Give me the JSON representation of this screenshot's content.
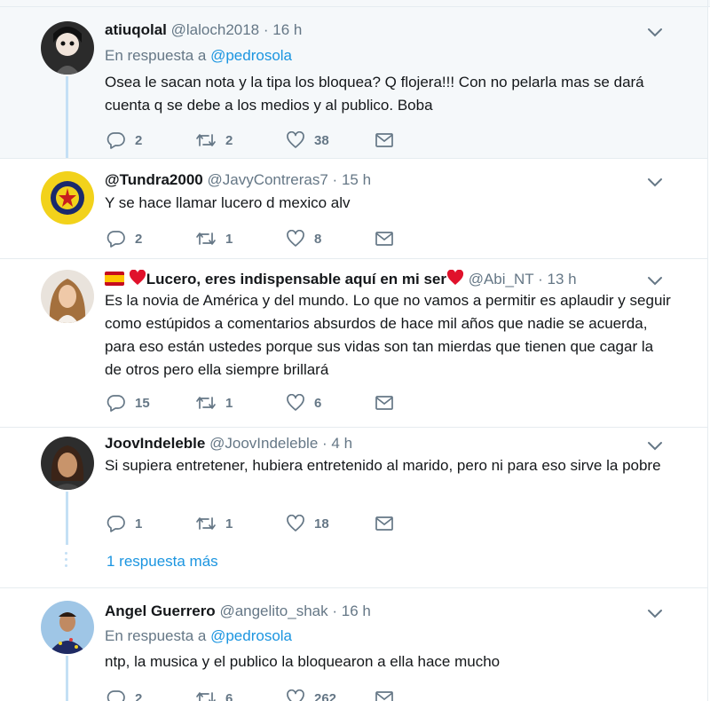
{
  "colors": {
    "name": "#14171a",
    "meta": "#657786",
    "link": "#1b95e0",
    "thread": "#c4e0f5",
    "highlight": "#f5f8fa"
  },
  "tweets": [
    {
      "name": "atiuqolal",
      "handle": "@laloch2018",
      "time": "16 h",
      "reply_prefix": "En respuesta a",
      "reply_mention": "@pedrosola",
      "text": "Osea le sacan nota y la tipa los bloquea? Q flojera!!! Con no pelarla mas se dará cuenta q se debe a los medios y al publico. Boba",
      "replies": "2",
      "retweets": "2",
      "likes": "38"
    },
    {
      "name": "@Tundra2000",
      "handle": "@JavyContreras7",
      "time": "15 h",
      "text": "Y se hace llamar lucero d mexico alv",
      "replies": "2",
      "retweets": "1",
      "likes": "8"
    },
    {
      "name": "Lucero, eres indispensable aquí en mi ser",
      "handle": "@Abi_NT",
      "time": "13 h",
      "text": "Es la novia de América y del mundo. Lo que no vamos a permitir es aplaudir y seguir como estúpidos a comentarios absurdos de hace mil años que nadie se acuerda, para eso están ustedes porque sus vidas son tan mierdas que tienen que cagar la de otros pero ella siempre brillará",
      "replies": "15",
      "retweets": "1",
      "likes": "6"
    },
    {
      "name": "JoovIndeleble",
      "handle": "@JoovIndeleble",
      "time": "4 h",
      "text": "Si supiera entretener, hubiera entretenido al marido, pero ni para eso sirve la pobre",
      "replies": "1",
      "retweets": "1",
      "likes": "18"
    },
    {
      "name": "Angel Guerrero",
      "handle": "@angelito_shak",
      "time": "16 h",
      "reply_prefix": "En respuesta a",
      "reply_mention": "@pedrosola",
      "text": "ntp, la musica y el publico la bloquearon a ella hace mucho",
      "replies": "2",
      "retweets": "6",
      "likes": "262"
    }
  ],
  "more_replies": "1 respuesta más",
  "separator_dot": "·",
  "icons": [
    "reply-icon",
    "retweet-icon",
    "like-icon",
    "direct-message-icon",
    "chevron-down-icon"
  ]
}
